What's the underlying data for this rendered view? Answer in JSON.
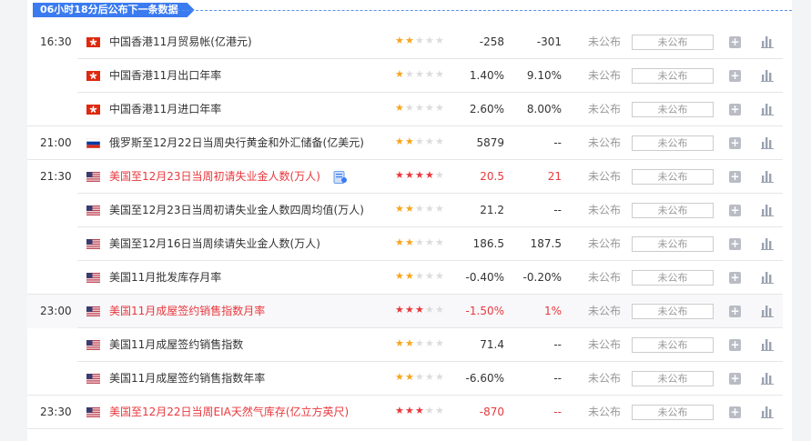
{
  "banner": {
    "text": "06小时18分后公布下一条数据"
  },
  "colors": {
    "accent": "#3a7bf0",
    "red": "#e8383d",
    "star_gold": "#f5a623",
    "star_red": "#e8383d",
    "star_empty": "#dcdcdc"
  },
  "rows": [
    {
      "time": "16:30",
      "flag": "hk",
      "name": "中国香港11月贸易帐(亿港元)",
      "stars": 2,
      "star_color": "gold",
      "prev": "-258",
      "consensus": "-301",
      "status": "未公布",
      "actual": "未公布",
      "red": false,
      "has_doc": false,
      "alt": false
    },
    {
      "time": "",
      "flag": "hk",
      "name": "中国香港11月出口年率",
      "stars": 1,
      "star_color": "gold",
      "prev": "1.40%",
      "consensus": "9.10%",
      "status": "未公布",
      "actual": "未公布",
      "red": false,
      "has_doc": false,
      "alt": false
    },
    {
      "time": "",
      "flag": "hk",
      "name": "中国香港11月进口年率",
      "stars": 1,
      "star_color": "gold",
      "prev": "2.60%",
      "consensus": "8.00%",
      "status": "未公布",
      "actual": "未公布",
      "red": false,
      "has_doc": false,
      "alt": false
    },
    {
      "time": "21:00",
      "flag": "ru",
      "name": "俄罗斯至12月22日当周央行黄金和外汇储备(亿美元)",
      "stars": 2,
      "star_color": "gold",
      "prev": "5879",
      "consensus": "--",
      "status": "未公布",
      "actual": "未公布",
      "red": false,
      "has_doc": false,
      "alt": false
    },
    {
      "time": "21:30",
      "flag": "us",
      "name": "美国至12月23日当周初请失业金人数(万人)",
      "stars": 4,
      "star_color": "red",
      "prev": "20.5",
      "consensus": "21",
      "status": "未公布",
      "actual": "未公布",
      "red": true,
      "has_doc": true,
      "alt": false
    },
    {
      "time": "",
      "flag": "us",
      "name": "美国至12月23日当周初请失业金人数四周均值(万人)",
      "stars": 2,
      "star_color": "gold",
      "prev": "21.2",
      "consensus": "--",
      "status": "未公布",
      "actual": "未公布",
      "red": false,
      "has_doc": false,
      "alt": false
    },
    {
      "time": "",
      "flag": "us",
      "name": "美国至12月16日当周续请失业金人数(万人)",
      "stars": 2,
      "star_color": "gold",
      "prev": "186.5",
      "consensus": "187.5",
      "status": "未公布",
      "actual": "未公布",
      "red": false,
      "has_doc": false,
      "alt": false
    },
    {
      "time": "",
      "flag": "us",
      "name": "美国11月批发库存月率",
      "stars": 2,
      "star_color": "gold",
      "prev": "-0.40%",
      "consensus": "-0.20%",
      "status": "未公布",
      "actual": "未公布",
      "red": false,
      "has_doc": false,
      "alt": false
    },
    {
      "time": "23:00",
      "flag": "us",
      "name": "美国11月成屋签约销售指数月率",
      "stars": 3,
      "star_color": "red",
      "prev": "-1.50%",
      "consensus": "1%",
      "status": "未公布",
      "actual": "未公布",
      "red": true,
      "has_doc": false,
      "alt": true
    },
    {
      "time": "",
      "flag": "us",
      "name": "美国11月成屋签约销售指数",
      "stars": 2,
      "star_color": "gold",
      "prev": "71.4",
      "consensus": "--",
      "status": "未公布",
      "actual": "未公布",
      "red": false,
      "has_doc": false,
      "alt": false
    },
    {
      "time": "",
      "flag": "us",
      "name": "美国11月成屋签约销售指数年率",
      "stars": 2,
      "star_color": "gold",
      "prev": "-6.60%",
      "consensus": "--",
      "status": "未公布",
      "actual": "未公布",
      "red": false,
      "has_doc": false,
      "alt": false
    },
    {
      "time": "23:30",
      "flag": "us",
      "name": "美国至12月22日当周EIA天然气库存(亿立方英尺)",
      "stars": 3,
      "star_color": "red",
      "prev": "-870",
      "consensus": "--",
      "status": "未公布",
      "actual": "未公布",
      "red": true,
      "has_doc": false,
      "alt": false
    }
  ]
}
